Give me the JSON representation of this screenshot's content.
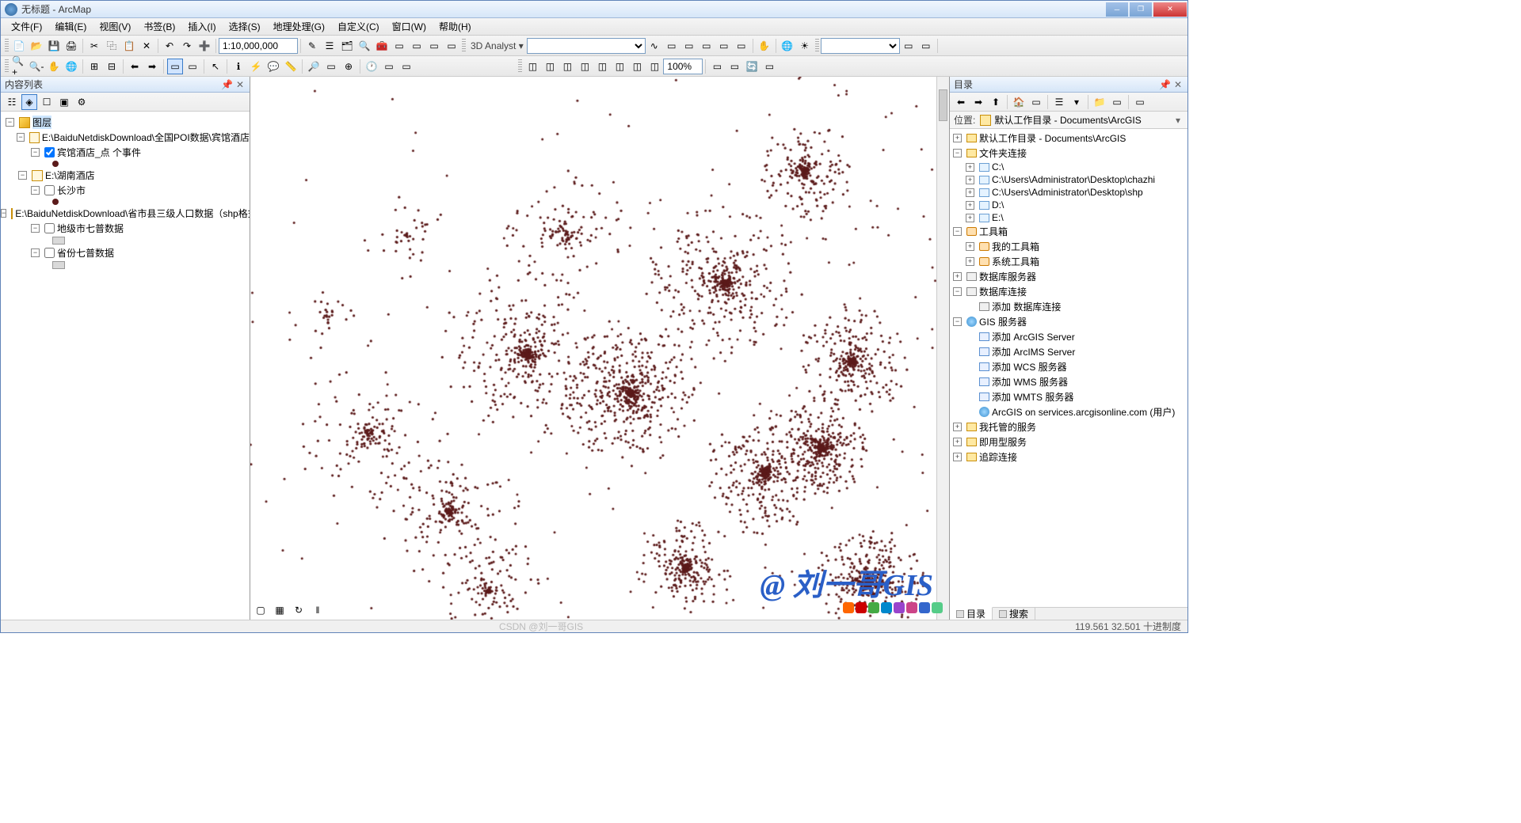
{
  "title": "无标题 - ArcMap",
  "menu": [
    "文件(F)",
    "编辑(E)",
    "视图(V)",
    "书签(B)",
    "插入(I)",
    "选择(S)",
    "地理处理(G)",
    "自定义(C)",
    "窗口(W)",
    "帮助(H)"
  ],
  "toolbar1": {
    "scale": "1:10,000,000",
    "analyst_label": "3D Analyst ▾",
    "zoom_pct": "100%"
  },
  "toc": {
    "title": "内容列表",
    "root": "图层",
    "group1": "E:\\BaiduNetdiskDownload\\全国POI数据\\宾馆酒店",
    "layer1": "宾馆酒店_点 个事件",
    "group2": "E:\\湖南酒店",
    "layer2": "长沙市",
    "group3": "E:\\BaiduNetdiskDownload\\省市县三级人口数据（shp格式）",
    "layer3": "地级市七普数据",
    "layer4": "省份七普数据"
  },
  "catalog": {
    "title": "目录",
    "loc_label": "位置:",
    "loc_text": "默认工作目录 - Documents\\ArcGIS",
    "home": "默认工作目录 - Documents\\ArcGIS",
    "folder_conn": "文件夹连接",
    "drives": [
      "C:\\",
      "C:\\Users\\Administrator\\Desktop\\chazhi",
      "C:\\Users\\Administrator\\Desktop\\shp",
      "D:\\",
      "E:\\"
    ],
    "toolbox": "工具箱",
    "my_tools": "我的工具箱",
    "sys_tools": "系统工具箱",
    "db_servers": "数据库服务器",
    "db_conn": "数据库连接",
    "add_db": "添加 数据库连接",
    "gis_servers": "GIS 服务器",
    "add_arcgis": "添加 ArcGIS Server",
    "add_arcims": "添加 ArcIMS Server",
    "add_wcs": "添加 WCS 服务器",
    "add_wms": "添加 WMS 服务器",
    "add_wmts": "添加 WMTS 服务器",
    "arcgis_online": "ArcGIS on services.arcgisonline.com (用户)",
    "my_hosted": "我托管的服务",
    "ready_svc": "即用型服务",
    "track_conn": "追踪连接"
  },
  "bottom": {
    "tab1": "目录",
    "tab2": "搜索"
  },
  "status": {
    "csdn": "CSDN @刘一哥GIS",
    "coords": "119.561 32.501 十进制度"
  },
  "watermark": "@ 刘一哥GIS"
}
